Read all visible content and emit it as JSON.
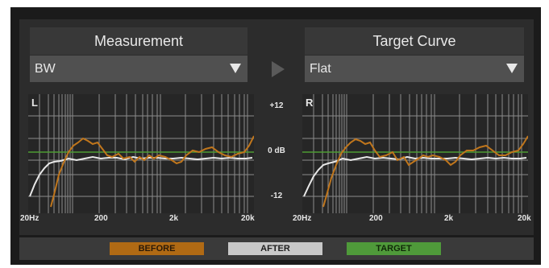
{
  "measurement": {
    "title": "Measurement",
    "selected": "BW"
  },
  "target": {
    "title": "Target Curve",
    "selected": "Flat"
  },
  "left_channel": {
    "label": "L"
  },
  "right_channel": {
    "label": "R"
  },
  "db_scale": {
    "top": "+12",
    "mid": "0 dB",
    "bottom": "-12"
  },
  "freq_labels": [
    "20Hz",
    "200",
    "2k",
    "20k"
  ],
  "legend": {
    "before": "BEFORE",
    "after": "AFTER",
    "target": "TARGET"
  },
  "colors": {
    "before": "#c0761c",
    "after": "#e8e8e8",
    "target": "#4d9b32",
    "before_legend": "#b06a14",
    "after_legend": "#c8c8c8",
    "target_legend": "#4f9a3a"
  }
}
